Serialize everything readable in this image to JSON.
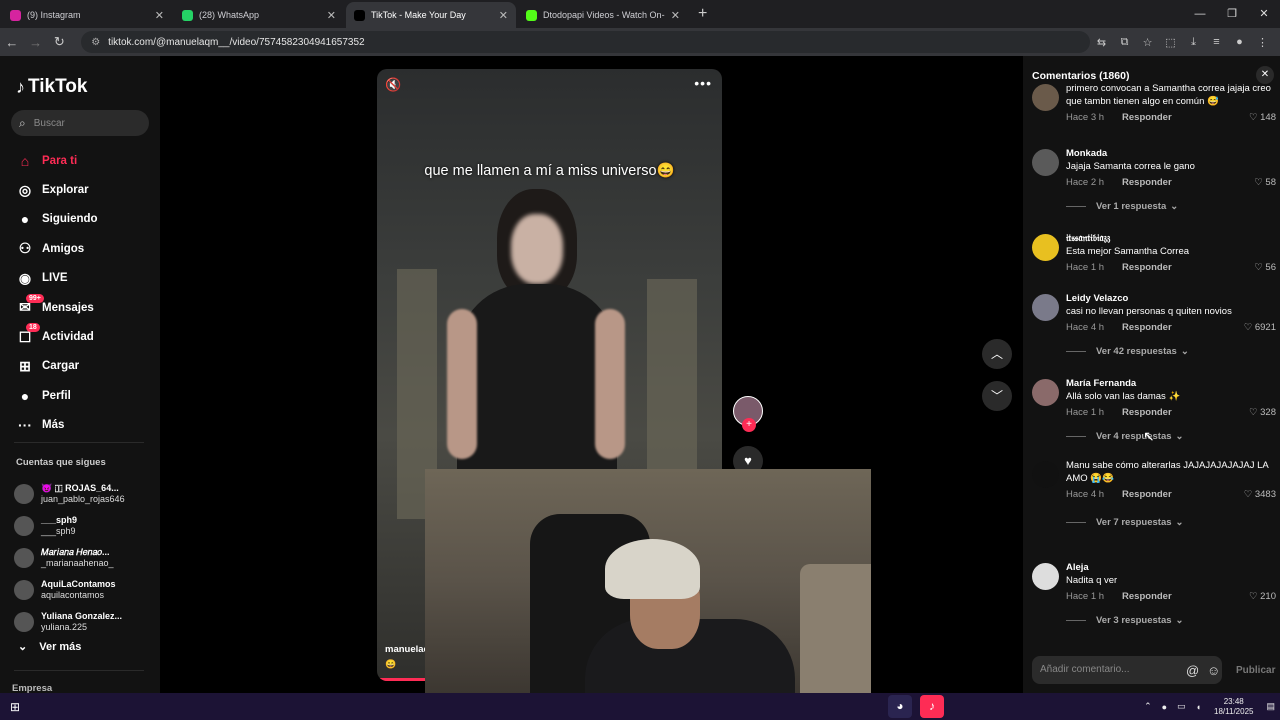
{
  "browser": {
    "tabs": [
      {
        "title": "(9) Instagram",
        "color": "#d6249f",
        "active": false
      },
      {
        "title": "(28) WhatsApp",
        "color": "#25d366",
        "active": false
      },
      {
        "title": "TikTok - Make Your Day",
        "color": "#000000",
        "active": true
      },
      {
        "title": "Dtodopapi Videos - Watch On-",
        "color": "#53fc18",
        "active": false
      }
    ],
    "new_tab": "+",
    "url": "tiktok.com/@manuelaqm__/video/7574582304941657352"
  },
  "sidebar": {
    "logo": "TikTok",
    "search_placeholder": "Buscar",
    "nav": [
      {
        "label": "Para ti",
        "icon": "home-icon",
        "glyph": "⌂",
        "active": true,
        "badge": ""
      },
      {
        "label": "Explorar",
        "icon": "compass-icon",
        "glyph": "◎",
        "active": false,
        "badge": ""
      },
      {
        "label": "Siguiendo",
        "icon": "following-icon",
        "glyph": "●",
        "active": false,
        "badge": ""
      },
      {
        "label": "Amigos",
        "icon": "friends-icon",
        "glyph": "⚇",
        "active": false,
        "badge": ""
      },
      {
        "label": "LIVE",
        "icon": "live-icon",
        "glyph": "◉",
        "active": false,
        "badge": ""
      },
      {
        "label": "Mensajes",
        "icon": "messages-icon",
        "glyph": "✉",
        "active": false,
        "badge": "99+"
      },
      {
        "label": "Actividad",
        "icon": "activity-icon",
        "glyph": "☐",
        "active": false,
        "badge": "18"
      },
      {
        "label": "Cargar",
        "icon": "upload-icon",
        "glyph": "⊞",
        "active": false,
        "badge": ""
      },
      {
        "label": "Perfil",
        "icon": "profile-icon",
        "glyph": "●",
        "active": false,
        "badge": ""
      },
      {
        "label": "Más",
        "icon": "more-icon",
        "glyph": "···",
        "active": false,
        "badge": ""
      }
    ],
    "following_title": "Cuentas que sigues",
    "following": [
      {
        "name": "😈 🇮 ROJAS_64...",
        "handle": "juan_pablo_rojas646"
      },
      {
        "name": "___sph9",
        "handle": "___sph9"
      },
      {
        "name": "𝑀𝑎𝑟𝑖𝑎𝑛𝑎 𝐻𝑒𝑛𝑎𝑜...",
        "handle": "_marianaahenao_"
      },
      {
        "name": "AquiLaContamos",
        "handle": "aquilacontamos"
      },
      {
        "name": "Yuliana Gonzalez...",
        "handle": "yuliana.225"
      }
    ],
    "see_more": "Ver más",
    "footer": "Empresa"
  },
  "video": {
    "caption": "que me llamen a mí a miss universo😄",
    "author": "manuelac",
    "emoji": "😄"
  },
  "comments": {
    "title": "Comentarios (1860)",
    "reply_label": "Responder",
    "items": [
      {
        "user": "",
        "text": "primero convocan a Samantha correa jajaja creo que tambn tienen algo en común 😅",
        "time": "Hace 3 h",
        "likes": "148",
        "replies": "",
        "avatar": "#6a5a4a"
      },
      {
        "user": "Monkada",
        "text": "Jajaja Samanta correa le gano",
        "time": "Hace 2 h",
        "likes": "58",
        "replies": "Ver 1 respuesta",
        "avatar": "#5a5a5a"
      },
      {
        "user": "𝔦𝔱𝔰𝔰𝔞𝔫𝔱𝔦𝔟𝔦𝔞𝔷𝔷",
        "text": "Esta mejor Samantha Correa",
        "time": "Hace 1 h",
        "likes": "56",
        "replies": "",
        "avatar": "#e8c020"
      },
      {
        "user": "Leidy Velazco",
        "text": "casi no llevan personas q quiten novios",
        "time": "Hace 4 h",
        "likes": "6921",
        "replies": "Ver 42 respuestas",
        "avatar": "#7a7a8a"
      },
      {
        "user": "María Fernanda",
        "text": "Allá solo van las damas ✨",
        "time": "Hace 1 h",
        "likes": "328",
        "replies": "Ver 4 respuestas",
        "avatar": "#8a6a6a"
      },
      {
        "user": "",
        "text": "Manu sabe cómo alterarlas JAJAJAJAJAJAJ LA AMO 😭😂",
        "time": "Hace 4 h",
        "likes": "3483",
        "replies": "Ver 7 respuestas",
        "avatar": "#111111"
      },
      {
        "user": "Aleja",
        "text": "Nadita q ver",
        "time": "Hace 1 h",
        "likes": "210",
        "replies": "Ver 3 respuestas",
        "avatar": "#dddddd"
      }
    ],
    "input_placeholder": "Añadir comentario...",
    "publish": "Publicar"
  },
  "taskbar": {
    "time": "23:48",
    "date": "18/11/2025"
  }
}
